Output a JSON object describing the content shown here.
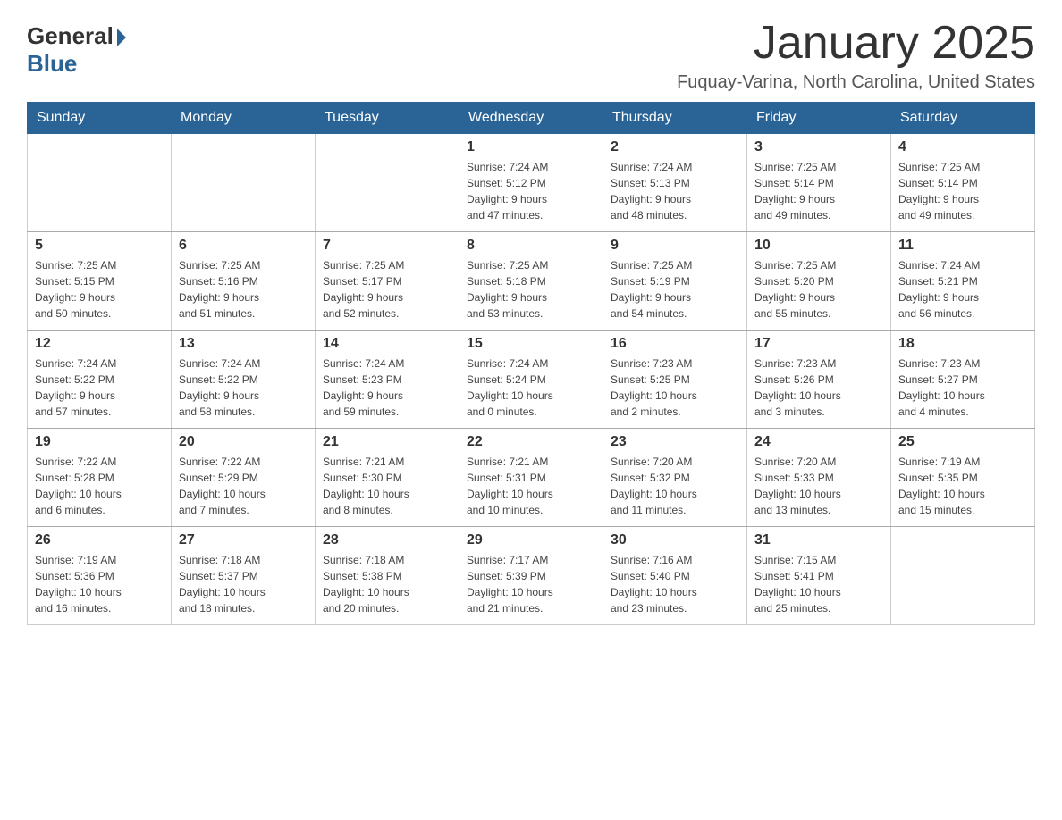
{
  "header": {
    "logo_general": "General",
    "logo_blue": "Blue",
    "title": "January 2025",
    "location": "Fuquay-Varina, North Carolina, United States"
  },
  "days_of_week": [
    "Sunday",
    "Monday",
    "Tuesday",
    "Wednesday",
    "Thursday",
    "Friday",
    "Saturday"
  ],
  "weeks": [
    [
      {
        "day": "",
        "info": ""
      },
      {
        "day": "",
        "info": ""
      },
      {
        "day": "",
        "info": ""
      },
      {
        "day": "1",
        "info": "Sunrise: 7:24 AM\nSunset: 5:12 PM\nDaylight: 9 hours\nand 47 minutes."
      },
      {
        "day": "2",
        "info": "Sunrise: 7:24 AM\nSunset: 5:13 PM\nDaylight: 9 hours\nand 48 minutes."
      },
      {
        "day": "3",
        "info": "Sunrise: 7:25 AM\nSunset: 5:14 PM\nDaylight: 9 hours\nand 49 minutes."
      },
      {
        "day": "4",
        "info": "Sunrise: 7:25 AM\nSunset: 5:14 PM\nDaylight: 9 hours\nand 49 minutes."
      }
    ],
    [
      {
        "day": "5",
        "info": "Sunrise: 7:25 AM\nSunset: 5:15 PM\nDaylight: 9 hours\nand 50 minutes."
      },
      {
        "day": "6",
        "info": "Sunrise: 7:25 AM\nSunset: 5:16 PM\nDaylight: 9 hours\nand 51 minutes."
      },
      {
        "day": "7",
        "info": "Sunrise: 7:25 AM\nSunset: 5:17 PM\nDaylight: 9 hours\nand 52 minutes."
      },
      {
        "day": "8",
        "info": "Sunrise: 7:25 AM\nSunset: 5:18 PM\nDaylight: 9 hours\nand 53 minutes."
      },
      {
        "day": "9",
        "info": "Sunrise: 7:25 AM\nSunset: 5:19 PM\nDaylight: 9 hours\nand 54 minutes."
      },
      {
        "day": "10",
        "info": "Sunrise: 7:25 AM\nSunset: 5:20 PM\nDaylight: 9 hours\nand 55 minutes."
      },
      {
        "day": "11",
        "info": "Sunrise: 7:24 AM\nSunset: 5:21 PM\nDaylight: 9 hours\nand 56 minutes."
      }
    ],
    [
      {
        "day": "12",
        "info": "Sunrise: 7:24 AM\nSunset: 5:22 PM\nDaylight: 9 hours\nand 57 minutes."
      },
      {
        "day": "13",
        "info": "Sunrise: 7:24 AM\nSunset: 5:22 PM\nDaylight: 9 hours\nand 58 minutes."
      },
      {
        "day": "14",
        "info": "Sunrise: 7:24 AM\nSunset: 5:23 PM\nDaylight: 9 hours\nand 59 minutes."
      },
      {
        "day": "15",
        "info": "Sunrise: 7:24 AM\nSunset: 5:24 PM\nDaylight: 10 hours\nand 0 minutes."
      },
      {
        "day": "16",
        "info": "Sunrise: 7:23 AM\nSunset: 5:25 PM\nDaylight: 10 hours\nand 2 minutes."
      },
      {
        "day": "17",
        "info": "Sunrise: 7:23 AM\nSunset: 5:26 PM\nDaylight: 10 hours\nand 3 minutes."
      },
      {
        "day": "18",
        "info": "Sunrise: 7:23 AM\nSunset: 5:27 PM\nDaylight: 10 hours\nand 4 minutes."
      }
    ],
    [
      {
        "day": "19",
        "info": "Sunrise: 7:22 AM\nSunset: 5:28 PM\nDaylight: 10 hours\nand 6 minutes."
      },
      {
        "day": "20",
        "info": "Sunrise: 7:22 AM\nSunset: 5:29 PM\nDaylight: 10 hours\nand 7 minutes."
      },
      {
        "day": "21",
        "info": "Sunrise: 7:21 AM\nSunset: 5:30 PM\nDaylight: 10 hours\nand 8 minutes."
      },
      {
        "day": "22",
        "info": "Sunrise: 7:21 AM\nSunset: 5:31 PM\nDaylight: 10 hours\nand 10 minutes."
      },
      {
        "day": "23",
        "info": "Sunrise: 7:20 AM\nSunset: 5:32 PM\nDaylight: 10 hours\nand 11 minutes."
      },
      {
        "day": "24",
        "info": "Sunrise: 7:20 AM\nSunset: 5:33 PM\nDaylight: 10 hours\nand 13 minutes."
      },
      {
        "day": "25",
        "info": "Sunrise: 7:19 AM\nSunset: 5:35 PM\nDaylight: 10 hours\nand 15 minutes."
      }
    ],
    [
      {
        "day": "26",
        "info": "Sunrise: 7:19 AM\nSunset: 5:36 PM\nDaylight: 10 hours\nand 16 minutes."
      },
      {
        "day": "27",
        "info": "Sunrise: 7:18 AM\nSunset: 5:37 PM\nDaylight: 10 hours\nand 18 minutes."
      },
      {
        "day": "28",
        "info": "Sunrise: 7:18 AM\nSunset: 5:38 PM\nDaylight: 10 hours\nand 20 minutes."
      },
      {
        "day": "29",
        "info": "Sunrise: 7:17 AM\nSunset: 5:39 PM\nDaylight: 10 hours\nand 21 minutes."
      },
      {
        "day": "30",
        "info": "Sunrise: 7:16 AM\nSunset: 5:40 PM\nDaylight: 10 hours\nand 23 minutes."
      },
      {
        "day": "31",
        "info": "Sunrise: 7:15 AM\nSunset: 5:41 PM\nDaylight: 10 hours\nand 25 minutes."
      },
      {
        "day": "",
        "info": ""
      }
    ]
  ]
}
